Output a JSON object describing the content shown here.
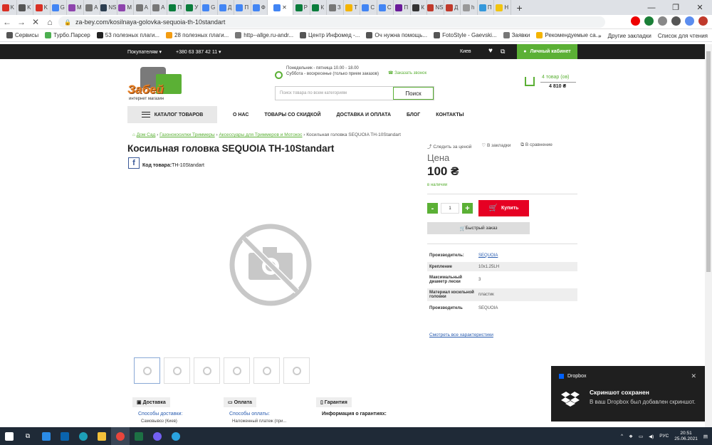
{
  "browser": {
    "tabs": [
      {
        "label": "K",
        "color": "#d93025"
      },
      {
        "label": "K",
        "color": "#555"
      },
      {
        "label": "K",
        "color": "#d93025"
      },
      {
        "label": "G",
        "color": "#4285f4"
      },
      {
        "label": "M",
        "color": "#8e44ad"
      },
      {
        "label": "A",
        "color": "#777"
      },
      {
        "label": "NS",
        "color": "#2c3e50"
      },
      {
        "label": "M",
        "color": "#8e44ad"
      },
      {
        "label": "A",
        "color": "#777"
      },
      {
        "label": "A",
        "color": "#777"
      },
      {
        "label": "П",
        "color": "#0a7d3c"
      },
      {
        "label": "У",
        "color": "#0a7d3c"
      },
      {
        "label": "G",
        "color": "#4285f4"
      },
      {
        "label": "Д",
        "color": "#4285f4"
      },
      {
        "label": "П",
        "color": "#4285f4"
      },
      {
        "label": "Ф",
        "color": "#4285f4"
      },
      {
        "label": "",
        "color": "#4285f4",
        "active": true
      },
      {
        "label": "Р",
        "color": "#0a7d3c"
      },
      {
        "label": "К",
        "color": "#0a7d3c"
      },
      {
        "label": "З",
        "color": "#777"
      },
      {
        "label": "Т",
        "color": "#f4b400"
      },
      {
        "label": "С",
        "color": "#4285f4"
      },
      {
        "label": "С",
        "color": "#4285f4"
      },
      {
        "label": "П",
        "color": "#6a1b9a"
      },
      {
        "label": "К",
        "color": "#333"
      },
      {
        "label": "NS",
        "color": "#c0392b"
      },
      {
        "label": "Д",
        "color": "#c0392b"
      },
      {
        "label": "h",
        "color": "#999"
      },
      {
        "label": "П",
        "color": "#3498db"
      },
      {
        "label": "Н",
        "color": "#f1c40f"
      }
    ],
    "url": "za-bey.com/kosilnaya-golovka-sequoia-th-10standart",
    "bookmarks": [
      "Сервисы",
      "Турбо.Парсер",
      "53 полезных плаги...",
      "28 полезных плаги...",
      "http--allge.ru-andr...",
      "Центр Инфомед -...",
      "Оч нужна помощь...",
      "FotoStyle - Gaevski...",
      "Заявки",
      "Рекомендуемые са..."
    ],
    "bookmarks_right": [
      "»",
      "Другие закладки",
      "Список для чтения"
    ]
  },
  "site": {
    "topbar": {
      "buyers": "Покупателям ▾",
      "phone": "+380 63 387 42 11 ▾",
      "city": "Киев",
      "cabinet": "Личный кабинет"
    },
    "logo": {
      "word": "Забей",
      "sub": "интернет магазин"
    },
    "schedule": {
      "line1": "Понедельник - пятница 10.00 - 18.00",
      "line2": "Суббота - воскресенье (только прием заказов)"
    },
    "callback": "Заказать звонок",
    "search": {
      "placeholder": "Поиск товара по всем категориям",
      "button": "Поиск"
    },
    "cart": {
      "count": "4 товар (ов)",
      "sum": "4 810 ₴"
    },
    "nav": {
      "catalog": "КАТАЛОГ ТОВАРОВ",
      "links": [
        "О НАС",
        "ТОВАРЫ СО СКИДКОЙ",
        "ДОСТАВКА И ОПЛАТА",
        "БЛОГ",
        "КОНТАКТЫ"
      ]
    },
    "breadcrumb": [
      "Дом Сад",
      "Газонокосилки Триммеры",
      "Аксессуары для Триммеров и Мотокос",
      "Косильная головка SEQUOIA TH-10Standart"
    ],
    "product": {
      "title": "Косильная головка SEQUOIA TH-10Standart",
      "code_label": "Код товара:",
      "code": "TH-10Standart",
      "price_label": "Цена",
      "price": "100 ₴",
      "stock": "в наличии",
      "qty": "1",
      "buy": "Купить",
      "fast": "Быстрый заказ",
      "actions": [
        "Следить за ценой",
        "В закладки",
        "В сравнение"
      ]
    },
    "specs": [
      {
        "k": "Производитель:",
        "v": "SEQUOIA",
        "link": true
      },
      {
        "k": "Крепление",
        "v": "10x1.25LH"
      },
      {
        "k": "Максимальный диаметр лески",
        "v": "3"
      },
      {
        "k": "Материал косильной головки",
        "v": "пластик"
      },
      {
        "k": "Производитель",
        "v": "SEQUOIA"
      }
    ],
    "all_specs": "Смотреть все характеристики",
    "info": {
      "delivery": {
        "title": "Доставка",
        "link": "Способы доставки:",
        "sub": "Самовывоз (Киев)"
      },
      "payment": {
        "title": "Оплата",
        "link": "Способы оплаты:",
        "sub": "Наложенный платеж (при..."
      },
      "warranty": {
        "title": "Гарантия",
        "link": "Информация о гарантиях:"
      }
    }
  },
  "toast": {
    "app": "Dropbox",
    "title": "Скриншот сохранен",
    "body": "В ваш Dropbox был добавлен скриншот."
  },
  "taskbar": {
    "lang": "РУС",
    "time": "20:51",
    "date": "25.06.2021"
  }
}
